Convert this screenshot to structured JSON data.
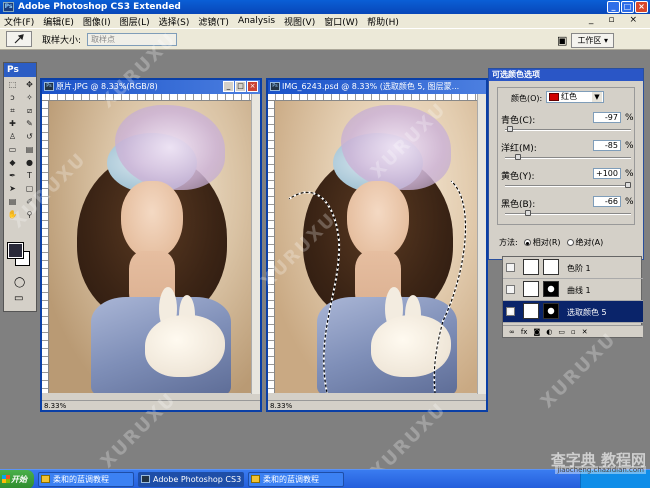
{
  "app": {
    "title": "Adobe Photoshop CS3 Extended",
    "window_buttons": [
      "_",
      "□",
      "×"
    ]
  },
  "menu": [
    "文件(F)",
    "编辑(E)",
    "图像(I)",
    "图层(L)",
    "选择(S)",
    "滤镜(T)",
    "Analysis",
    "视图(V)",
    "窗口(W)",
    "帮助(H)"
  ],
  "options_bar": {
    "sample_size_label": "取样大小:",
    "sample_size_value": "取样点",
    "workspace_label": "工作区 ▾"
  },
  "toolbox": {
    "title": "Ps"
  },
  "docs": [
    {
      "title": "原片.JPG @ 8.33%(RGB/8)",
      "zoom": "8.33%"
    },
    {
      "title": "IMG_6243.psd @ 8.33% (选取颜色 5, 图层蒙...",
      "zoom": "8.33%"
    }
  ],
  "selective_color": {
    "title": "可选颜色选项",
    "color_label": "颜色(O):",
    "color_value": "红色",
    "color_chip": "#d00000",
    "channels": [
      {
        "label": "青色(C):",
        "value": "-97",
        "unit": "%",
        "position": 0.02
      },
      {
        "label": "洋红(M):",
        "value": "-85",
        "unit": "%",
        "position": 0.08
      },
      {
        "label": "黄色(Y):",
        "value": "+100",
        "unit": "%",
        "position": 1.0
      },
      {
        "label": "黑色(B):",
        "value": "-66",
        "unit": "%",
        "position": 0.17
      }
    ],
    "method_label": "方法:",
    "method_relative": "相对(R)",
    "method_absolute": "绝对(A)"
  },
  "layers": [
    {
      "name": "色阶 1"
    },
    {
      "name": "曲线 1"
    },
    {
      "name": "选取颜色 5"
    }
  ],
  "taskbar": {
    "start": "开始",
    "items": [
      "柔和的蓝调教程",
      "Adobe Photoshop CS3 E...",
      "柔和的蓝调教程"
    ]
  },
  "watermark_text": "XURUXU",
  "site": {
    "name": "查字典 教程网",
    "url": "jiaocheng.chazidian.com"
  }
}
